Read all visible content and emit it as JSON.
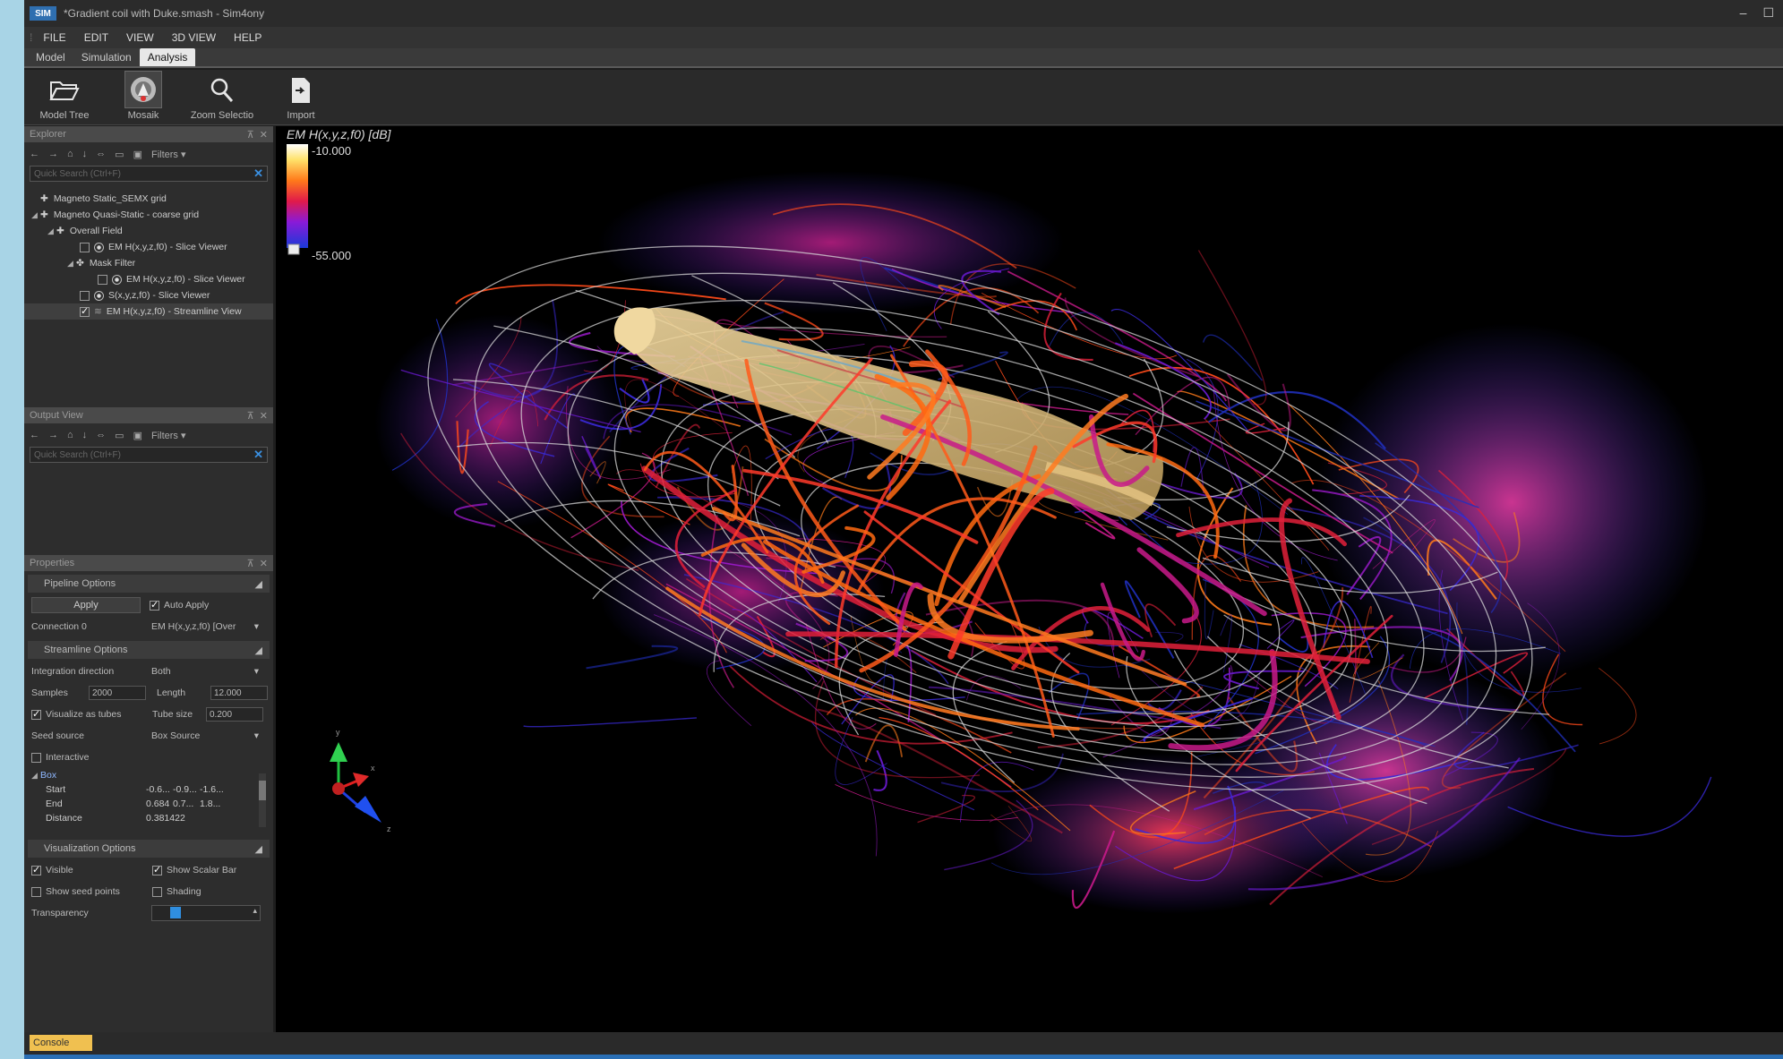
{
  "window": {
    "logo": "SIM",
    "title": "*Gradient coil with Duke.smash - Sim4ony"
  },
  "menu": [
    "FILE",
    "EDIT",
    "VIEW",
    "3D VIEW",
    "HELP"
  ],
  "tabs": [
    "Model",
    "Simulation",
    "Analysis"
  ],
  "ribbon": [
    "Model Tree",
    "Mosaik",
    "Zoom Selectio",
    "Import"
  ],
  "explorer": {
    "title": "Explorer",
    "filters": "Filters",
    "search_placeholder": "Quick Search (Ctrl+F)",
    "tree": [
      "Magneto Static_SEMX grid",
      "Magneto Quasi-Static - coarse grid",
      "Overall Field",
      "EM H(x,y,z,f0) - Slice Viewer",
      "Mask Filter",
      "EM H(x,y,z,f0) - Slice Viewer",
      "S(x,y,z,f0) - Slice Viewer",
      "EM H(x,y,z,f0) - Streamline View"
    ]
  },
  "output": {
    "title": "Output View",
    "filters": "Filters",
    "search_placeholder": "Quick Search (Ctrl+F)"
  },
  "properties": {
    "title": "Properties",
    "pipeline_options": "Pipeline Options",
    "apply": "Apply",
    "auto_apply": "Auto Apply",
    "connection_label": "Connection 0",
    "connection_value": "EM H(x,y,z,f0) [Over",
    "streamline_options": "Streamline Options",
    "integration_label": "Integration direction",
    "integration_value": "Both",
    "samples_label": "Samples",
    "samples_value": "2000",
    "length_label": "Length",
    "length_value": "12.000",
    "tubes_label": "Visualize as tubes",
    "tube_size_label": "Tube size",
    "tube_size_value": "0.200",
    "seed_label": "Seed source",
    "seed_value": "Box Source",
    "interactive": "Interactive",
    "box": "Box",
    "start_label": "Start",
    "start_values": [
      "-0.6...",
      "-0.9...",
      "-1.6..."
    ],
    "end_label": "End",
    "end_values": [
      "0.684",
      "0.7...",
      "1.8..."
    ],
    "distance_label": "Distance",
    "distance_value": "0.381422",
    "vis_options": "Visualization Options",
    "visible": "Visible",
    "show_scalar_bar": "Show Scalar Bar",
    "show_seed_points": "Show seed points",
    "shading": "Shading",
    "transparency": "Transparency"
  },
  "viewport": {
    "legend_title": "EM H(x,y,z,f0) [dB]",
    "max_label": "-10.000",
    "min_label": "-55.000",
    "axes": {
      "x": "x",
      "y": "y",
      "z": "z"
    }
  },
  "status": {
    "console": "Console"
  },
  "colors": {
    "accent_blue": "#2a6fb5",
    "console_tab": "#f0c050"
  }
}
